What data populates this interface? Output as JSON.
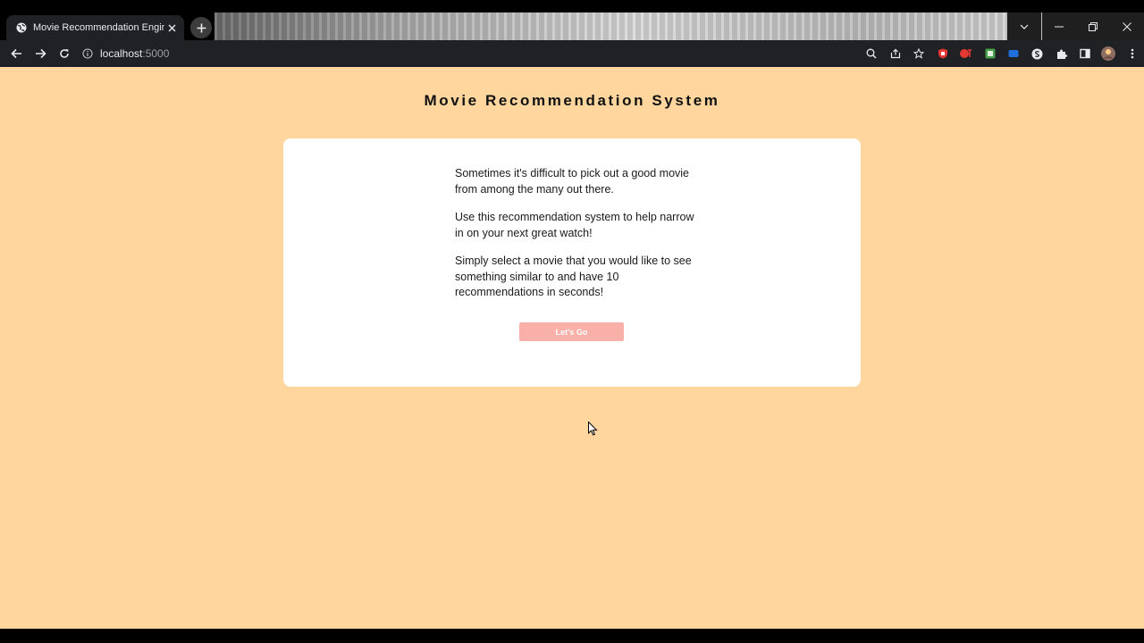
{
  "browser": {
    "tab_title": "Movie Recommendation Engine",
    "url_host": "localhost",
    "url_port": ":5000",
    "extension_colors": [
      "#e53935",
      "#e53935",
      "#43a047",
      "#1e6fd9",
      "#e8eaed"
    ]
  },
  "page": {
    "title": "Movie Recommendation System",
    "paragraphs": [
      "Sometimes it's difficult to pick out a good movie from among the many out there.",
      "Use this recommendation system to help narrow in on your next great watch!",
      "Simply select a movie that you would like to see something similar to and have 10 recommendations in seconds!"
    ],
    "cta_label": "Let's Go"
  },
  "colors": {
    "background": "#ffd69e",
    "card": "#ffffff",
    "button": "#f9b0a8"
  }
}
